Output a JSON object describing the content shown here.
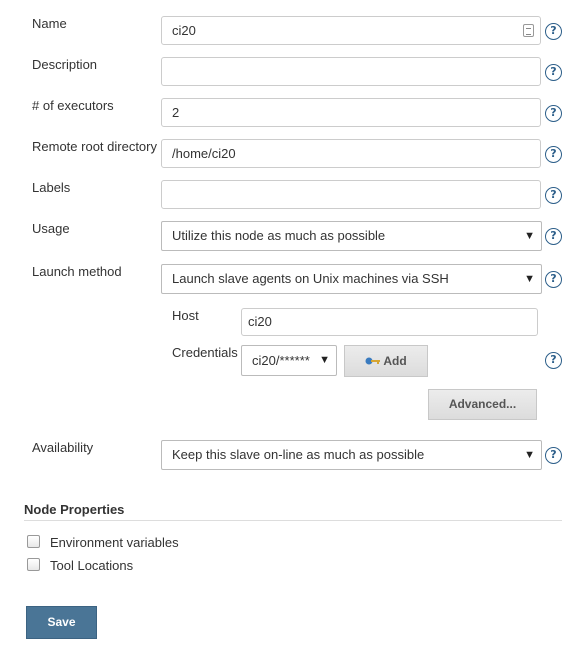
{
  "form": {
    "name": {
      "label": "Name",
      "value": "ci20"
    },
    "description": {
      "label": "Description",
      "value": ""
    },
    "executors": {
      "label": "# of executors",
      "value": "2"
    },
    "remote_root": {
      "label": "Remote root directory",
      "value": "/home/ci20"
    },
    "labels": {
      "label": "Labels",
      "value": ""
    },
    "usage": {
      "label": "Usage",
      "value": "Utilize this node as much as possible"
    },
    "launch_method": {
      "label": "Launch method",
      "value": "Launch slave agents on Unix machines via SSH"
    },
    "host": {
      "label": "Host",
      "value": "ci20"
    },
    "credentials": {
      "label": "Credentials",
      "value": "ci20/******",
      "add_label": "Add"
    },
    "advanced_label": "Advanced...",
    "availability": {
      "label": "Availability",
      "value": "Keep this slave on-line as much as possible"
    }
  },
  "node_properties": {
    "title": "Node Properties",
    "items": [
      {
        "label": "Environment variables",
        "checked": false
      },
      {
        "label": "Tool Locations",
        "checked": false
      }
    ]
  },
  "help_glyph": "?",
  "caret_glyph": "▼",
  "save_label": "Save",
  "colors": {
    "help": "#2d5f8a",
    "save_button": "#4a7596"
  }
}
